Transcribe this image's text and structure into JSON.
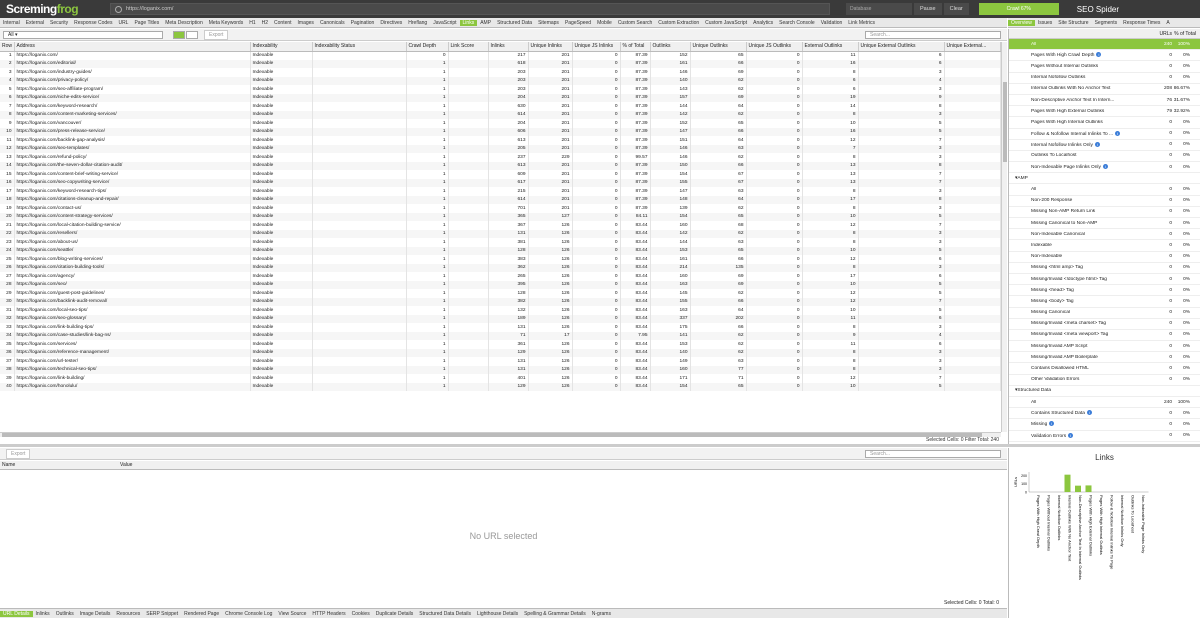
{
  "app": {
    "logo_a": "Scre",
    "logo_b": "ming",
    "logo_c": "frog",
    "url": "https://loganix.com/",
    "mode": "Database",
    "pause": "Pause",
    "clear": "Clear",
    "crawl": "Crawl 67%",
    "brand": "SEO Spider"
  },
  "tabs": [
    {
      "label": "Internal",
      "active": false
    },
    {
      "label": "External",
      "active": false
    },
    {
      "label": "Security",
      "active": false
    },
    {
      "label": "Response Codes",
      "active": false
    },
    {
      "label": "URL",
      "active": false
    },
    {
      "label": "Page Titles",
      "active": false
    },
    {
      "label": "Meta Description",
      "active": false
    },
    {
      "label": "Meta Keywords",
      "active": false
    },
    {
      "label": "H1",
      "active": false
    },
    {
      "label": "H2",
      "active": false
    },
    {
      "label": "Content",
      "active": false
    },
    {
      "label": "Images",
      "active": false
    },
    {
      "label": "Canonicals",
      "active": false
    },
    {
      "label": "Pagination",
      "active": false
    },
    {
      "label": "Directives",
      "active": false
    },
    {
      "label": "Hreflang",
      "active": false
    },
    {
      "label": "JavaScript",
      "active": false
    },
    {
      "label": "Links",
      "active": true
    },
    {
      "label": "AMP",
      "active": false
    },
    {
      "label": "Structured Data",
      "active": false
    },
    {
      "label": "Sitemaps",
      "active": false
    },
    {
      "label": "PageSpeed",
      "active": false
    },
    {
      "label": "Mobile",
      "active": false
    },
    {
      "label": "Custom Search",
      "active": false
    },
    {
      "label": "Custom Extraction",
      "active": false
    },
    {
      "label": "Custom JavaScript",
      "active": false
    },
    {
      "label": "Analytics",
      "active": false
    },
    {
      "label": "Search Console",
      "active": false
    },
    {
      "label": "Validation",
      "active": false
    },
    {
      "label": "Link Metrics",
      "active": false
    }
  ],
  "right_tabs": [
    {
      "label": "Overview",
      "active": true
    },
    {
      "label": "Issues",
      "active": false
    },
    {
      "label": "Site Structure",
      "active": false
    },
    {
      "label": "Segments",
      "active": false
    },
    {
      "label": "Response Times",
      "active": false
    },
    {
      "label": "A",
      "active": false
    }
  ],
  "filter": {
    "value": "All",
    "export": "Export",
    "search_placeholder": "Search..."
  },
  "columns": [
    "Row",
    "Address",
    "Indexability",
    "Indexability Status",
    "Crawl Depth",
    "Link Score",
    "Inlinks",
    "Unique Inlinks",
    "Unique JS Inlinks",
    "% of Total",
    "Outlinks",
    "Unique Outlinks",
    "Unique JS Outlinks",
    "External Outlinks",
    "Unique External Outlinks",
    "Unique External..."
  ],
  "rows": [
    [
      "1",
      "https://loganix.com/",
      "Indexable",
      "",
      "0",
      "",
      "217",
      "201",
      "0",
      "87.39",
      "152",
      "65",
      "0",
      "11",
      "6"
    ],
    [
      "2",
      "https://loganix.com/editorial/",
      "Indexable",
      "",
      "1",
      "",
      "618",
      "201",
      "0",
      "87.39",
      "161",
      "66",
      "0",
      "16",
      "6"
    ],
    [
      "3",
      "https://loganix.com/industry-guides/",
      "Indexable",
      "",
      "1",
      "",
      "203",
      "201",
      "0",
      "87.39",
      "146",
      "69",
      "0",
      "8",
      "3"
    ],
    [
      "4",
      "https://loganix.com/privacy-policy/",
      "Indexable",
      "",
      "1",
      "",
      "203",
      "201",
      "0",
      "87.39",
      "140",
      "62",
      "0",
      "6",
      "4"
    ],
    [
      "5",
      "https://loganix.com/seo-affiliate-program/",
      "Indexable",
      "",
      "1",
      "",
      "203",
      "201",
      "0",
      "87.39",
      "143",
      "62",
      "0",
      "6",
      "3"
    ],
    [
      "6",
      "https://loganix.com/niche-edits-service/",
      "Indexable",
      "",
      "1",
      "",
      "204",
      "201",
      "0",
      "87.39",
      "157",
      "69",
      "0",
      "19",
      "9"
    ],
    [
      "7",
      "https://loganix.com/keyword-research/",
      "Indexable",
      "",
      "1",
      "",
      "630",
      "201",
      "0",
      "87.39",
      "144",
      "64",
      "0",
      "14",
      "8"
    ],
    [
      "8",
      "https://loganix.com/content-marketing-services/",
      "Indexable",
      "",
      "1",
      "",
      "614",
      "201",
      "0",
      "87.39",
      "142",
      "62",
      "0",
      "8",
      "3"
    ],
    [
      "9",
      "https://loganix.com/vancouver/",
      "Indexable",
      "",
      "1",
      "",
      "204",
      "201",
      "0",
      "87.39",
      "152",
      "65",
      "0",
      "10",
      "5"
    ],
    [
      "10",
      "https://loganix.com/press-release-service/",
      "Indexable",
      "",
      "1",
      "",
      "606",
      "201",
      "0",
      "87.39",
      "147",
      "66",
      "0",
      "16",
      "5"
    ],
    [
      "11",
      "https://loganix.com/backlink-gap-analysis/",
      "Indexable",
      "",
      "1",
      "",
      "613",
      "201",
      "0",
      "87.39",
      "151",
      "64",
      "0",
      "12",
      "7"
    ],
    [
      "12",
      "https://loganix.com/seo-templates/",
      "Indexable",
      "",
      "1",
      "",
      "205",
      "201",
      "0",
      "87.39",
      "146",
      "63",
      "0",
      "7",
      "3"
    ],
    [
      "13",
      "https://loganix.com/refund-policy/",
      "Indexable",
      "",
      "1",
      "",
      "237",
      "229",
      "0",
      "99.57",
      "146",
      "62",
      "0",
      "8",
      "3"
    ],
    [
      "14",
      "https://loganix.com/the-seven-dollar-citation-audit/",
      "Indexable",
      "",
      "1",
      "",
      "613",
      "201",
      "0",
      "87.39",
      "150",
      "66",
      "0",
      "13",
      "8"
    ],
    [
      "15",
      "https://loganix.com/content-brief-writing-service/",
      "Indexable",
      "",
      "1",
      "",
      "609",
      "201",
      "0",
      "87.39",
      "154",
      "67",
      "0",
      "13",
      "7"
    ],
    [
      "16",
      "https://loganix.com/seo-copywriting-service/",
      "Indexable",
      "",
      "1",
      "",
      "617",
      "201",
      "0",
      "87.39",
      "155",
      "67",
      "0",
      "13",
      "7"
    ],
    [
      "17",
      "https://loganix.com/keyword-research-tips/",
      "Indexable",
      "",
      "1",
      "",
      "215",
      "201",
      "0",
      "87.39",
      "147",
      "63",
      "0",
      "8",
      "3"
    ],
    [
      "18",
      "https://loganix.com/citations-cleanup-and-repair/",
      "Indexable",
      "",
      "1",
      "",
      "614",
      "201",
      "0",
      "87.39",
      "148",
      "64",
      "0",
      "17",
      "8"
    ],
    [
      "19",
      "https://loganix.com/contact-us/",
      "Indexable",
      "",
      "1",
      "",
      "701",
      "201",
      "0",
      "87.39",
      "139",
      "62",
      "0",
      "8",
      "3"
    ],
    [
      "20",
      "https://loganix.com/content-strategy-services/",
      "Indexable",
      "",
      "1",
      "",
      "365",
      "127",
      "0",
      "84.11",
      "154",
      "65",
      "0",
      "10",
      "5"
    ],
    [
      "21",
      "https://loganix.com/local-citation-building-service/",
      "Indexable",
      "",
      "1",
      "",
      "367",
      "126",
      "0",
      "83.44",
      "160",
      "68",
      "0",
      "12",
      "7"
    ],
    [
      "22",
      "https://loganix.com/resellers/",
      "Indexable",
      "",
      "1",
      "",
      "131",
      "126",
      "0",
      "83.44",
      "142",
      "62",
      "0",
      "8",
      "3"
    ],
    [
      "23",
      "https://loganix.com/about-us/",
      "Indexable",
      "",
      "1",
      "",
      "381",
      "126",
      "0",
      "83.44",
      "144",
      "63",
      "0",
      "8",
      "3"
    ],
    [
      "24",
      "https://loganix.com/seattle/",
      "Indexable",
      "",
      "1",
      "",
      "128",
      "126",
      "0",
      "83.44",
      "153",
      "65",
      "0",
      "10",
      "5"
    ],
    [
      "25",
      "https://loganix.com/blog-writing-services/",
      "Indexable",
      "",
      "1",
      "",
      "383",
      "126",
      "0",
      "83.44",
      "161",
      "66",
      "0",
      "12",
      "6"
    ],
    [
      "26",
      "https://loganix.com/citation-building-tools/",
      "Indexable",
      "",
      "1",
      "",
      "362",
      "126",
      "0",
      "83.44",
      "214",
      "135",
      "0",
      "8",
      "3"
    ],
    [
      "27",
      "https://loganix.com/agency/",
      "Indexable",
      "",
      "1",
      "",
      "265",
      "126",
      "0",
      "83.44",
      "160",
      "69",
      "0",
      "17",
      "6"
    ],
    [
      "28",
      "https://loganix.com/seo/",
      "Indexable",
      "",
      "1",
      "",
      "395",
      "126",
      "0",
      "83.44",
      "163",
      "69",
      "0",
      "10",
      "5"
    ],
    [
      "29",
      "https://loganix.com/guest-post-guidelines/",
      "Indexable",
      "",
      "1",
      "",
      "128",
      "126",
      "0",
      "83.44",
      "145",
      "62",
      "0",
      "12",
      "5"
    ],
    [
      "30",
      "https://loganix.com/backlink-audit-removal/",
      "Indexable",
      "",
      "1",
      "",
      "382",
      "126",
      "0",
      "83.44",
      "155",
      "66",
      "0",
      "12",
      "7"
    ],
    [
      "31",
      "https://loganix.com/local-seo-tips/",
      "Indexable",
      "",
      "1",
      "",
      "132",
      "126",
      "0",
      "83.44",
      "163",
      "64",
      "0",
      "10",
      "5"
    ],
    [
      "32",
      "https://loganix.com/seo-glossary/",
      "Indexable",
      "",
      "1",
      "",
      "189",
      "126",
      "0",
      "83.44",
      "337",
      "202",
      "0",
      "11",
      "6"
    ],
    [
      "33",
      "https://loganix.com/link-building-tips/",
      "Indexable",
      "",
      "1",
      "",
      "131",
      "126",
      "0",
      "83.44",
      "175",
      "66",
      "0",
      "8",
      "3"
    ],
    [
      "34",
      "https://loganix.com/case-studies/link-bag-ns/",
      "Indexable",
      "",
      "1",
      "",
      "71",
      "17",
      "0",
      "7.95",
      "141",
      "62",
      "0",
      "9",
      "4"
    ],
    [
      "35",
      "https://loganix.com/services/",
      "Indexable",
      "",
      "1",
      "",
      "361",
      "126",
      "0",
      "83.44",
      "153",
      "62",
      "0",
      "11",
      "6"
    ],
    [
      "36",
      "https://loganix.com/reference-management/",
      "Indexable",
      "",
      "1",
      "",
      "129",
      "126",
      "0",
      "83.44",
      "140",
      "62",
      "0",
      "8",
      "3"
    ],
    [
      "37",
      "https://loganix.com/url-tester/",
      "Indexable",
      "",
      "1",
      "",
      "131",
      "126",
      "0",
      "83.44",
      "149",
      "63",
      "0",
      "8",
      "3"
    ],
    [
      "38",
      "https://loganix.com/technical-seo-tips/",
      "Indexable",
      "",
      "1",
      "",
      "131",
      "126",
      "0",
      "83.44",
      "160",
      "77",
      "0",
      "8",
      "3"
    ],
    [
      "39",
      "https://loganix.com/link-building/",
      "Indexable",
      "",
      "1",
      "",
      "401",
      "126",
      "0",
      "83.44",
      "171",
      "71",
      "0",
      "12",
      "7"
    ],
    [
      "40",
      "https://loganix.com/honolulu/",
      "Indexable",
      "",
      "1",
      "",
      "129",
      "126",
      "0",
      "83.44",
      "154",
      "65",
      "0",
      "10",
      "5"
    ]
  ],
  "status": {
    "selected": "Selected Cells: 0 Filter Total: 240",
    "bottom": "Selected Cells: 0 Total: 0"
  },
  "overview": {
    "header": {
      "urls": "URLs",
      "pct": "% of Total"
    },
    "items": [
      {
        "label": "All",
        "v1": "240",
        "v2": "100%",
        "type": "sel"
      },
      {
        "label": "Pages With High Crawl Depth",
        "v1": "0",
        "v2": "0%",
        "info": true
      },
      {
        "label": "Pages Without Internal Outlinks",
        "v1": "0",
        "v2": "0%"
      },
      {
        "label": "Internal Nofollow Outlinks",
        "v1": "0",
        "v2": "0%"
      },
      {
        "label": "Internal Outlinks With No Anchor Text",
        "v1": "208",
        "v2": "86.67%"
      },
      {
        "label": "Non-Descriptive Anchor Text In Intern...",
        "v1": "76",
        "v2": "31.67%"
      },
      {
        "label": "Pages With High External Outlinks",
        "v1": "79",
        "v2": "32.92%"
      },
      {
        "label": "Pages With High Internal Outlinks",
        "v1": "0",
        "v2": "0%"
      },
      {
        "label": "Follow & Nofollow Internal Inlinks To ...",
        "v1": "0",
        "v2": "0%",
        "info": true
      },
      {
        "label": "Internal Nofollow Inlinks Only",
        "v1": "0",
        "v2": "0%",
        "info": true
      },
      {
        "label": "Outlinks To Localhost",
        "v1": "0",
        "v2": "0%"
      },
      {
        "label": "Non-Indexable Page Inlinks Only",
        "v1": "0",
        "v2": "0%",
        "info": true
      },
      {
        "label": "AMP",
        "v1": "",
        "v2": "",
        "type": "sec"
      },
      {
        "label": "All",
        "v1": "0",
        "v2": "0%"
      },
      {
        "label": "Non-200 Response",
        "v1": "0",
        "v2": "0%"
      },
      {
        "label": "Missing Non-AMP Return Link",
        "v1": "0",
        "v2": "0%"
      },
      {
        "label": "Missing Canonical to Non-AMP",
        "v1": "0",
        "v2": "0%"
      },
      {
        "label": "Non-Indexable Canonical",
        "v1": "0",
        "v2": "0%"
      },
      {
        "label": "Indexable",
        "v1": "0",
        "v2": "0%"
      },
      {
        "label": "Non-Indexable",
        "v1": "0",
        "v2": "0%"
      },
      {
        "label": "Missing <html amp> Tag",
        "v1": "0",
        "v2": "0%"
      },
      {
        "label": "Missing/Invalid <!doctype html> Tag",
        "v1": "0",
        "v2": "0%"
      },
      {
        "label": "Missing <head> Tag",
        "v1": "0",
        "v2": "0%"
      },
      {
        "label": "Missing <body> Tag",
        "v1": "0",
        "v2": "0%"
      },
      {
        "label": "Missing Canonical",
        "v1": "0",
        "v2": "0%"
      },
      {
        "label": "Missing/Invalid <meta charset> Tag",
        "v1": "0",
        "v2": "0%"
      },
      {
        "label": "Missing/Invalid <meta viewport> Tag",
        "v1": "0",
        "v2": "0%"
      },
      {
        "label": "Missing/Invalid AMP Script",
        "v1": "0",
        "v2": "0%"
      },
      {
        "label": "Missing/Invalid AMP Boilerplate",
        "v1": "0",
        "v2": "0%"
      },
      {
        "label": "Contains Disallowed HTML",
        "v1": "0",
        "v2": "0%"
      },
      {
        "label": "Other Validation Errors",
        "v1": "0",
        "v2": "0%"
      },
      {
        "label": "Structured Data",
        "v1": "",
        "v2": "",
        "type": "sec"
      },
      {
        "label": "All",
        "v1": "240",
        "v2": "100%"
      },
      {
        "label": "Contains Structured Data",
        "v1": "0",
        "v2": "0%",
        "info": true
      },
      {
        "label": "Missing",
        "v1": "0",
        "v2": "0%",
        "info": true
      },
      {
        "label": "Validation Errors",
        "v1": "0",
        "v2": "0%",
        "info": true
      }
    ]
  },
  "bottom": {
    "export": "Export",
    "search_placeholder": "Search...",
    "col_name": "Name",
    "col_value": "Value",
    "empty": "No URL selected"
  },
  "bottom_tabs": [
    {
      "label": "URL Details",
      "active": true
    },
    {
      "label": "Inlinks",
      "active": false
    },
    {
      "label": "Outlinks",
      "active": false
    },
    {
      "label": "Image Details",
      "active": false
    },
    {
      "label": "Resources",
      "active": false
    },
    {
      "label": "SERP Snippet",
      "active": false
    },
    {
      "label": "Rendered Page",
      "active": false
    },
    {
      "label": "Chrome Console Log",
      "active": false
    },
    {
      "label": "View Source",
      "active": false
    },
    {
      "label": "HTTP Headers",
      "active": false
    },
    {
      "label": "Cookies",
      "active": false
    },
    {
      "label": "Duplicate Details",
      "active": false
    },
    {
      "label": "Structured Data Details",
      "active": false
    },
    {
      "label": "Lighthouse Details",
      "active": false
    },
    {
      "label": "Spelling & Grammar Details",
      "active": false
    },
    {
      "label": "N-grams",
      "active": false
    }
  ],
  "chart_data": {
    "type": "bar",
    "title": "Links",
    "ylabel": "URLs",
    "yticks": [
      "200",
      "100",
      "0"
    ],
    "ylim": [
      0,
      240
    ],
    "categories": [
      "Pages With High Crawl Depth",
      "Pages Without Internal Outlinks",
      "Internal Nofollow Outlinks",
      "Internal Outlinks With No Anchor Text",
      "Non-Descriptive Anchor Text In Internal Outlinks",
      "Pages With High External Outlinks",
      "Pages With High Internal Outlinks",
      "Follow & Nofollow Internal Inlinks To Page",
      "Internal Nofollow Inlinks Only",
      "Outlinks To Localhost",
      "Non-Indexable Page Inlinks Only"
    ],
    "values": [
      0,
      0,
      0,
      208,
      76,
      79,
      0,
      0,
      0,
      0,
      0
    ],
    "color": "#8cc63f"
  }
}
